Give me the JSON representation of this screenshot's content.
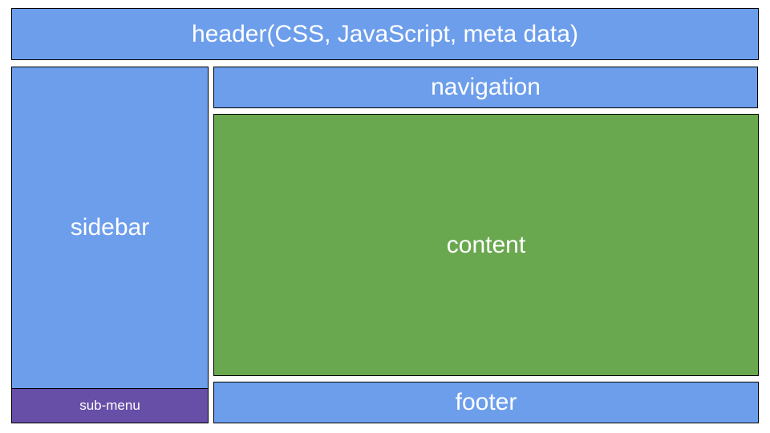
{
  "colors": {
    "blue_block": "#6d9eeb",
    "green_block": "#6aa84f",
    "purple_block": "#674ea7",
    "border": "#000000",
    "text": "#ffffff"
  },
  "header": {
    "label": "header(CSS, JavaScript, meta data)"
  },
  "navigation": {
    "label": "navigation"
  },
  "sidebar": {
    "label": "sidebar"
  },
  "sub_menu": {
    "label": "sub-menu"
  },
  "content": {
    "label": "content"
  },
  "footer": {
    "label": "footer"
  }
}
